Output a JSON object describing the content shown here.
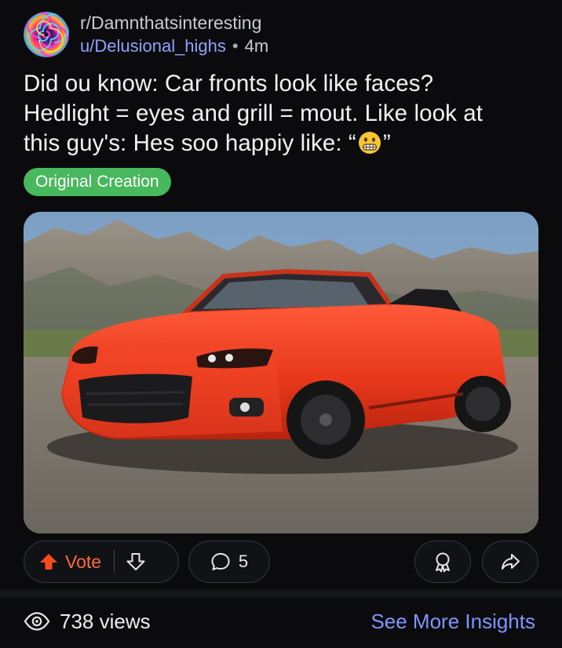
{
  "post": {
    "subreddit": "r/Damnthatsinteresting",
    "username": "u/Delusional_highs",
    "separator": "•",
    "time": "4m",
    "title_line1": "Did ou know: Car fronts look like faces?",
    "title_line2": "Hedlight = eyes and grill = mout. Like look at",
    "title_line3_prefix": "this guy's: Hes soo happiy like: “",
    "title_line3_suffix": "”",
    "flair": "Original Creation",
    "image_alt": "Red convertible sports car in front of mountains"
  },
  "actions": {
    "vote_label": "Vote",
    "comment_count": "5"
  },
  "footer": {
    "views": "738 views",
    "insights_link": "See More Insights"
  },
  "colors": {
    "background": "#0b0b0d",
    "accent": "#7f95ff",
    "upvote": "#ff6a3a",
    "flair": "#48b85d"
  },
  "icons": {
    "upvote": "upvote-arrow-icon",
    "downvote": "downvote-arrow-icon",
    "comment": "comment-bubble-icon",
    "award": "award-ribbon-icon",
    "share": "share-arrow-icon",
    "views": "eye-icon",
    "emoji": "grimacing-face-emoji"
  }
}
